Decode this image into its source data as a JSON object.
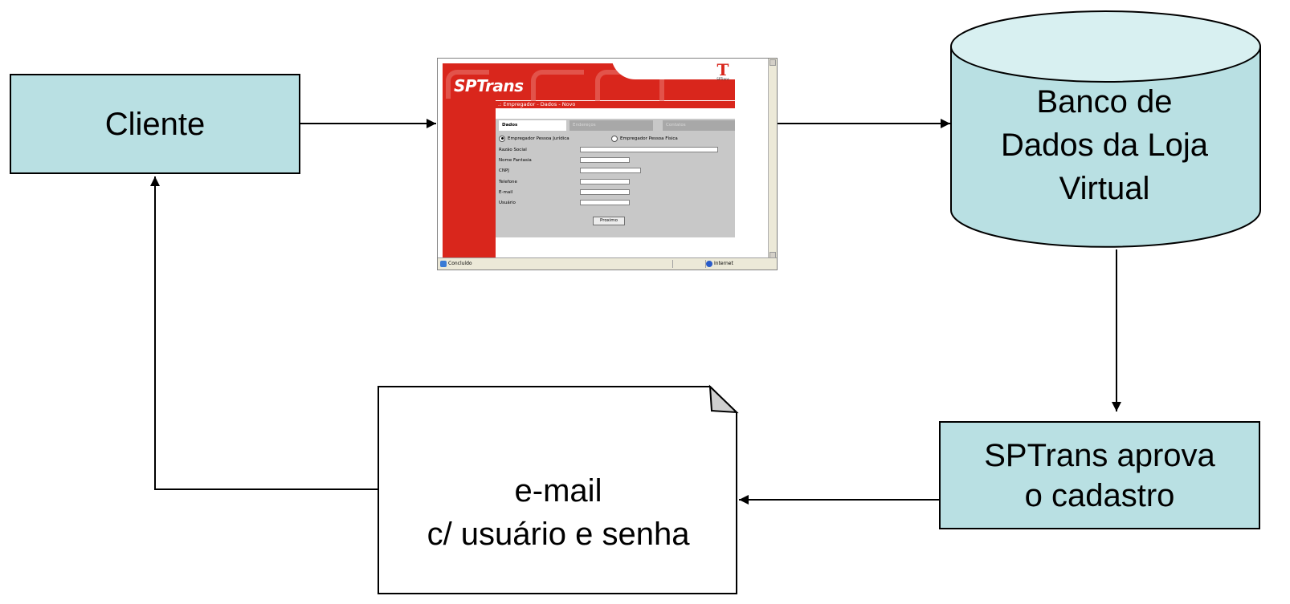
{
  "nodes": {
    "cliente": {
      "label": "Cliente"
    },
    "banco": {
      "lines": [
        "Banco de",
        "Dados da Loja",
        "Virtual"
      ]
    },
    "aprova": {
      "lines": [
        "SPTrans aprova",
        "o cadastro"
      ]
    },
    "email": {
      "lines": [
        "e-mail",
        "c/ usuário e senha"
      ]
    }
  },
  "colors": {
    "box_fill": "#b9e0e3",
    "line": "#000000",
    "brand_red": "#d9261c"
  },
  "screenshot": {
    "logo": "SPTrans",
    "brand_small": "SPTrans",
    "page_title": ".: Empregador - Dados - Novo",
    "tabs": [
      "Dados",
      "Endereços",
      "Contatos"
    ],
    "radio_options": [
      {
        "label": "Empregador Pessoa Jurídica",
        "selected": true
      },
      {
        "label": "Empregador Pessoa Física",
        "selected": false
      }
    ],
    "fields": [
      "Razão Social",
      "Nome Fantasia",
      "CNPJ",
      "Telefone",
      "E-mail",
      "Usuário"
    ],
    "button": "Proximo",
    "status_left": "Concluído",
    "status_right": "Internet"
  }
}
